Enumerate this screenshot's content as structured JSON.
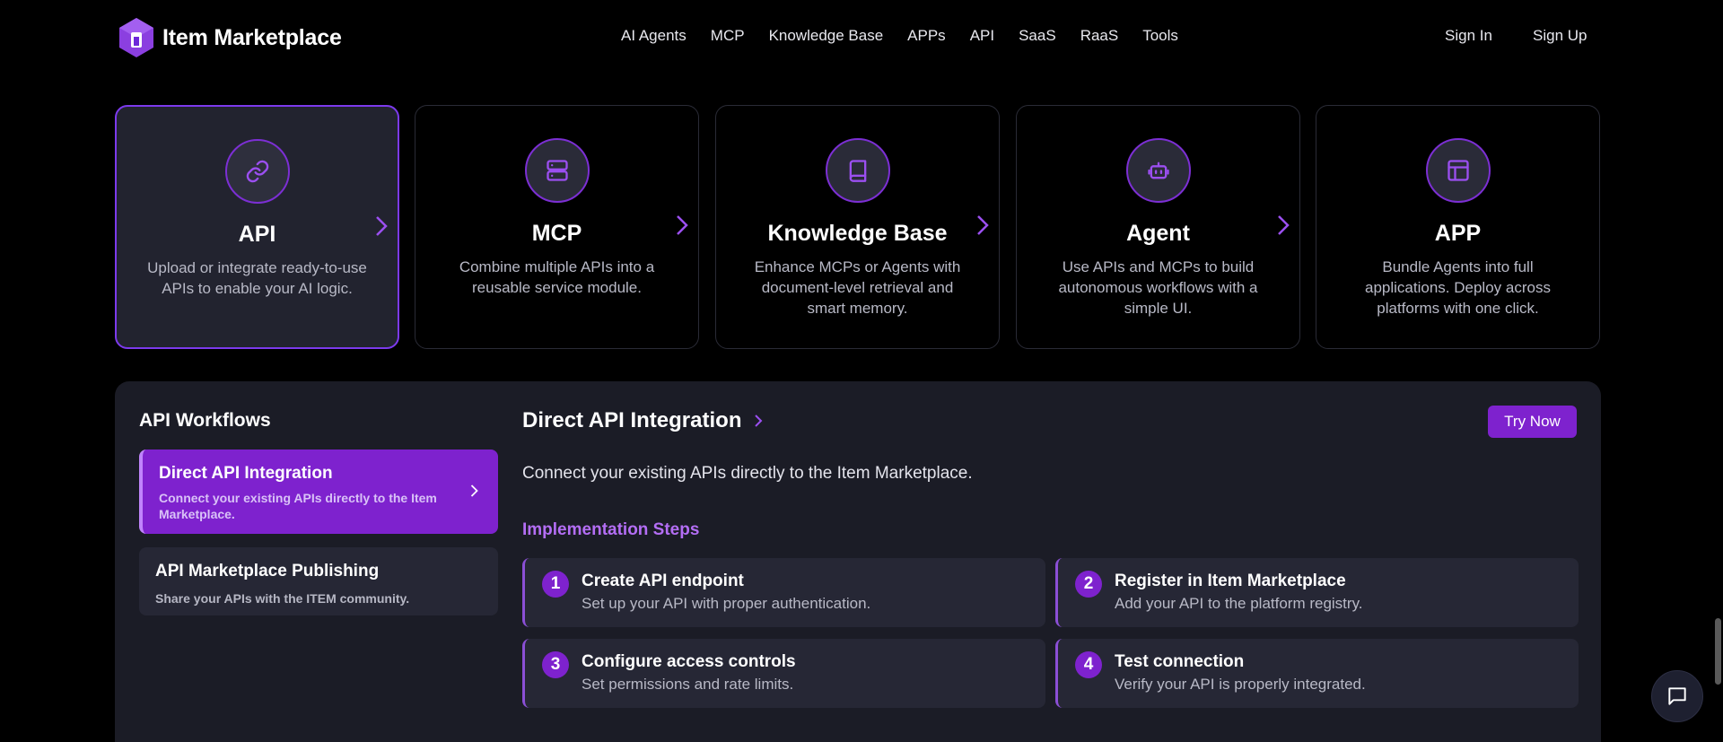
{
  "header": {
    "brand": "Item Marketplace",
    "nav": [
      "AI Agents",
      "MCP",
      "Knowledge Base",
      "APPs",
      "API",
      "SaaS",
      "RaaS",
      "Tools"
    ],
    "sign_in": "Sign In",
    "sign_up": "Sign Up"
  },
  "cards": [
    {
      "title": "API",
      "desc": "Upload or integrate ready-to-use APIs to enable your AI logic.",
      "icon": "link-icon",
      "active": true
    },
    {
      "title": "MCP",
      "desc": "Combine multiple APIs into a reusable service module.",
      "icon": "server-icon",
      "active": false
    },
    {
      "title": "Knowledge Base",
      "desc": "Enhance MCPs or Agents with document-level retrieval and smart memory.",
      "icon": "book-icon",
      "active": false
    },
    {
      "title": "Agent",
      "desc": "Use APIs and MCPs to build autonomous workflows with a simple UI.",
      "icon": "bot-icon",
      "active": false
    },
    {
      "title": "APP",
      "desc": "Bundle Agents into full applications. Deploy across platforms with one click.",
      "icon": "layout-icon",
      "active": false
    }
  ],
  "workflows": {
    "heading": "API Workflows",
    "items": [
      {
        "title": "Direct API Integration",
        "desc": "Connect your existing APIs directly to the Item Marketplace."
      },
      {
        "title": "API Marketplace Publishing",
        "desc": "Share your APIs with the ITEM community."
      }
    ]
  },
  "detail": {
    "title": "Direct API Integration",
    "try_label": "Try Now",
    "desc": "Connect your existing APIs directly to the Item Marketplace.",
    "steps_heading": "Implementation Steps",
    "steps": [
      {
        "num": "1",
        "title": "Create API endpoint",
        "desc": "Set up your API with proper authentication."
      },
      {
        "num": "2",
        "title": "Register in Item Marketplace",
        "desc": "Add your API to the platform registry."
      },
      {
        "num": "3",
        "title": "Configure access controls",
        "desc": "Set permissions and rate limits."
      },
      {
        "num": "4",
        "title": "Test connection",
        "desc": "Verify your API is properly integrated."
      }
    ]
  },
  "colors": {
    "accent": "#7e22ce",
    "accent_light": "#b46ef5",
    "background": "#000000",
    "panel": "#1b1c26"
  }
}
